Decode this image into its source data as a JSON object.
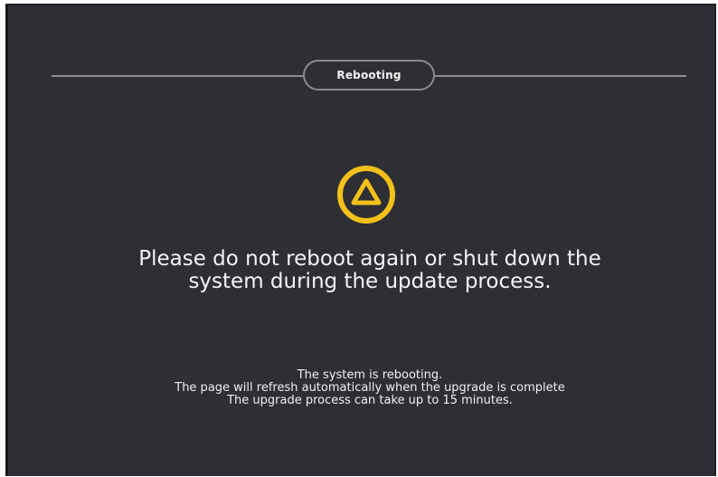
{
  "status": {
    "pill_label": "Rebooting"
  },
  "icon": {
    "name": "warning-triangle-icon",
    "color": "#f3c01a"
  },
  "message": {
    "line1": "Please do not reboot again or shut down the",
    "line2": "system during the update process."
  },
  "notes": {
    "line1": "The system is rebooting.",
    "line2": "The page will refresh automatically when the upgrade is complete",
    "line3": "The upgrade process can take up to 15 minutes."
  },
  "colors": {
    "background": "#2e2f34",
    "divider": "#8a8b90",
    "text": "#f4f4f4",
    "accent": "#f3c01a"
  }
}
